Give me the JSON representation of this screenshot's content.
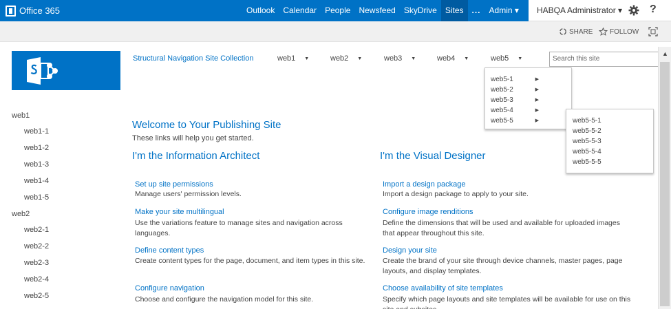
{
  "suitebar": {
    "brand": "Office 365",
    "nav": [
      "Outlook",
      "Calendar",
      "People",
      "Newsfeed",
      "SkyDrive",
      "Sites",
      "...",
      "Admin ▾"
    ],
    "active_index": 5,
    "user": "HABQA Administrator ▾",
    "help": "?"
  },
  "ribbon": {
    "share": "SHARE",
    "follow": "FOLLOW"
  },
  "topnav": {
    "site_title": "Structural Navigation Site Collection",
    "items": [
      "web1",
      "web2",
      "web3",
      "web4",
      "web5"
    ],
    "arrow": "▼",
    "search_placeholder": "Search this site"
  },
  "flyout1": {
    "items": [
      "web5-1",
      "web5-2",
      "web5-3",
      "web5-4",
      "web5-5"
    ],
    "arrow": "▶"
  },
  "flyout2": {
    "items": [
      "web5-5-1",
      "web5-5-2",
      "web5-5-3",
      "web5-5-4",
      "web5-5-5"
    ]
  },
  "quicklaunch": {
    "groups": [
      {
        "label": "web1",
        "children": [
          "web1-1",
          "web1-2",
          "web1-3",
          "web1-4",
          "web1-5"
        ]
      },
      {
        "label": "web2",
        "children": [
          "web2-1",
          "web2-2",
          "web2-3",
          "web2-4",
          "web2-5"
        ]
      }
    ]
  },
  "content": {
    "welcome": "Welcome to Your Publishing Site",
    "intro": "These links will help you get started.",
    "col1": {
      "heading": "I'm the Information Architect",
      "items": [
        {
          "link": "Set up site permissions",
          "desc": "Manage users' permission levels."
        },
        {
          "link": "Make your site multilingual",
          "desc": "Use the variations feature to manage sites and navigation across languages."
        },
        {
          "link": "Define content types",
          "desc": "Create content types for the page, document, and item types in this site."
        },
        {
          "link": "Configure navigation",
          "desc": "Choose and configure the navigation model for this site."
        }
      ]
    },
    "col2": {
      "heading": "I'm the Visual Designer",
      "items": [
        {
          "link": "Import a design package",
          "desc": "Import a design package to apply to your site."
        },
        {
          "link": "Configure image renditions",
          "desc": "Define the dimensions that will be used and available for uploaded images that appear throughout this site."
        },
        {
          "link": "Design your site",
          "desc": "Create the brand of your site through device channels, master pages, page layouts, and display templates."
        },
        {
          "link": "Choose availability of site templates",
          "desc": "Specify which page layouts and site templates will be available for use on this site and subsites."
        }
      ]
    }
  },
  "colors": {
    "brand_blue": "#0072c6",
    "link_blue": "#0072c6",
    "text": "#444444"
  }
}
